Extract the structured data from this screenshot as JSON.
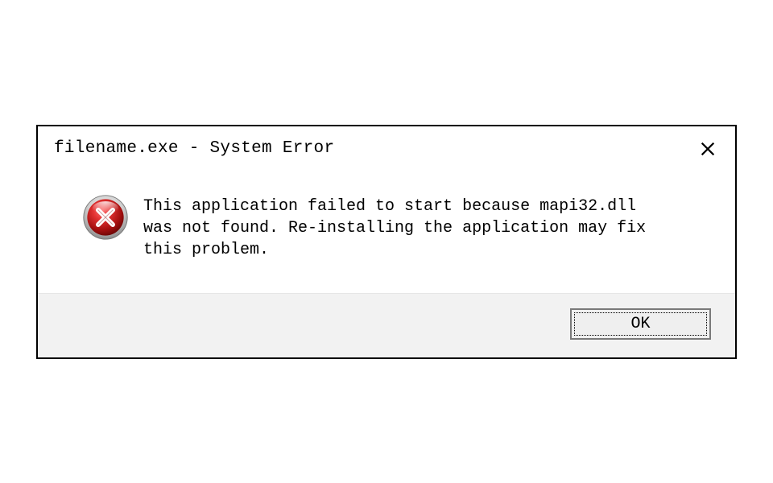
{
  "dialog": {
    "title": "filename.exe - System Error",
    "message": "This application failed to start because mapi32.dll was not found. Re-installing the application may fix this problem.",
    "ok_label": "OK"
  }
}
